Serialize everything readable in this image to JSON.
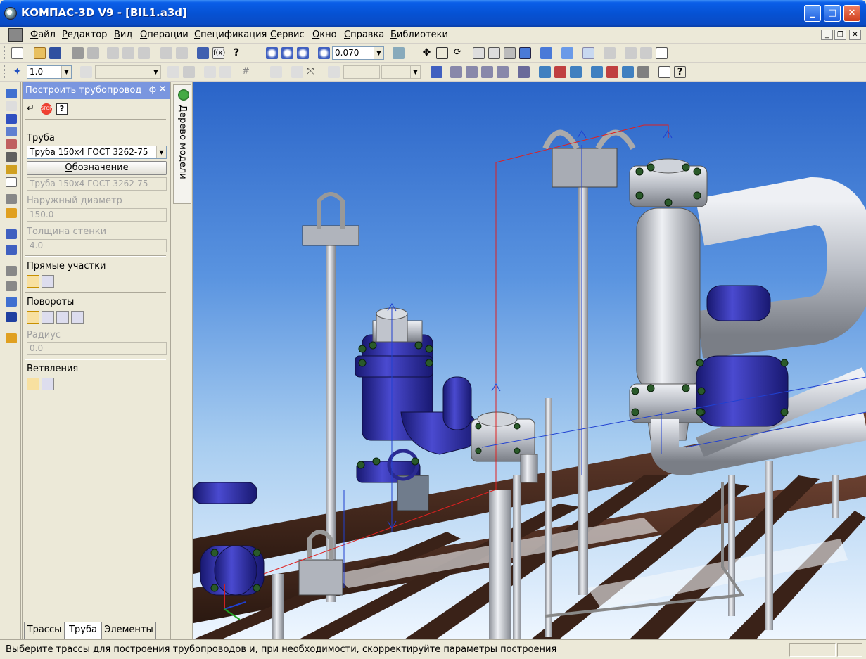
{
  "window": {
    "title": "КОМПАС-3D V9 - [BIL1.a3d]"
  },
  "menu": {
    "items": [
      "Файл",
      "Редактор",
      "Вид",
      "Операции",
      "Спецификация",
      "Сервис",
      "Окно",
      "Справка",
      "Библиотеки"
    ]
  },
  "toolbar1": {
    "zoom_value": "0.070"
  },
  "toolbar2": {
    "step_value": "1.0"
  },
  "panel": {
    "title": "Построить трубопровод",
    "pipe_section": "Труба",
    "pipe_selected": "Труба 150х4 ГОСТ 3262-75",
    "designation_button": "Обозначение",
    "designation_value": "Труба 150х4 ГОСТ 3262-75",
    "outer_diameter_label": "Наружный диаметр",
    "outer_diameter_value": "150.0",
    "wall_thickness_label": "Толщина стенки",
    "wall_thickness_value": "4.0",
    "straight_label": "Прямые участки",
    "turns_label": "Повороты",
    "radius_label": "Радиус",
    "radius_value": "0.0",
    "branches_label": "Ветвления",
    "tabs": [
      "Трассы",
      "Труба",
      "Элементы"
    ]
  },
  "tree": {
    "label": "Дерево модели"
  },
  "status": {
    "text": "Выберите трассы для построения трубопроводов и, при необходимости, скорректируйте параметры построения"
  },
  "colors": {
    "titlebar": "#0652d4",
    "panel_header": "#7a96df",
    "pipe_steel": "#b8bcc4",
    "valve_blue": "#2a2aa8",
    "frame_brown": "#4a2c22"
  }
}
